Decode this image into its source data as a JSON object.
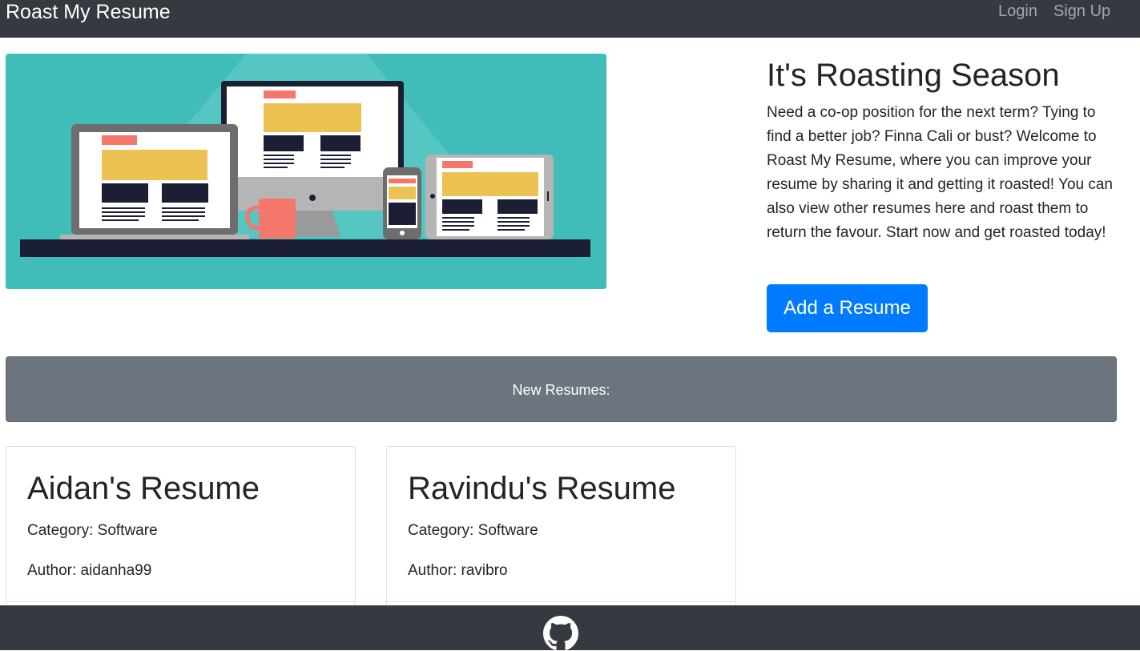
{
  "navbar": {
    "brand": "Roast My Resume",
    "links": [
      {
        "label": "Login"
      },
      {
        "label": "Sign Up"
      }
    ]
  },
  "hero": {
    "image_icon": "devices-illustration",
    "title": "It's Roasting Season",
    "lead": "Need a co-op position for the next term? Tying to find a better job? Finna Cali or bust? Welcome to Roast My Resume, where you can improve your resume by sharing it and getting it roasted! You can also view other resumes here and roast them to return the favour. Start now and get roasted today!",
    "button_label": "Add a Resume"
  },
  "banner": {
    "label": "New Resumes:"
  },
  "cards": [
    {
      "title": "Aidan's Resume",
      "category": "Category: Software",
      "author": "Author: aidanha99"
    },
    {
      "title": "Ravindu's Resume",
      "category": "Category: Software",
      "author": "Author: ravibro"
    }
  ],
  "footer": {
    "icon": "github-icon"
  },
  "colors": {
    "navbar_bg": "#343a40",
    "primary": "#007bff",
    "banner_bg": "#6c757d",
    "hero_bg": "#41bdb9"
  }
}
